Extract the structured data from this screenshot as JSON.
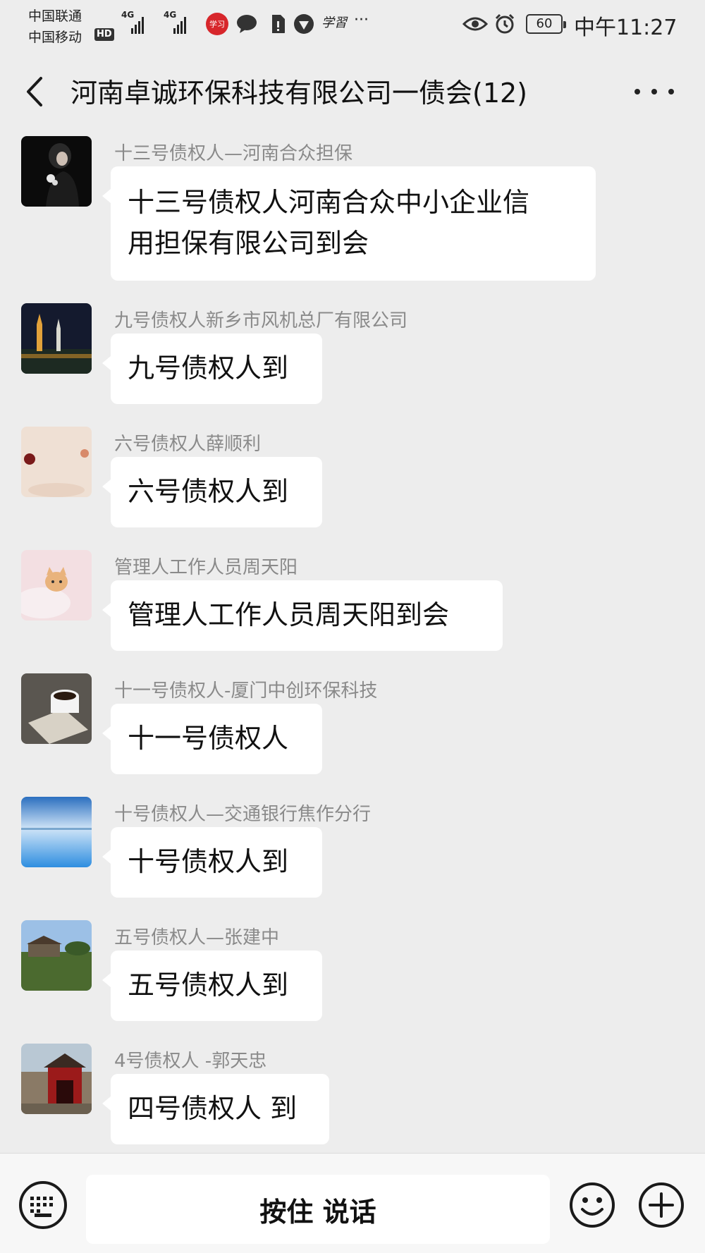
{
  "status_bar": {
    "carrier_1": "中国联通",
    "carrier_2": "中国移动",
    "hd": "HD",
    "network_1": "4G",
    "network_2": "4G",
    "app_badge": "学习",
    "xue_icon_text": "学習",
    "more": "···",
    "battery": "60",
    "time": "中午11:27"
  },
  "header": {
    "title": "河南卓诚环保科技有限公司一债会(12)"
  },
  "messages": [
    {
      "sender": "十三号债权人—河南合众担保",
      "text_line1": "十三号债权人河南合众中小企业信",
      "text_line2": "用担保有限公司到会"
    },
    {
      "sender": "九号债权人新乡市风机总厂有限公司",
      "text": "九号债权人到"
    },
    {
      "sender": "六号债权人薛顺利",
      "text": "六号债权人到"
    },
    {
      "sender": "管理人工作人员周天阳",
      "text": "管理人工作人员周天阳到会"
    },
    {
      "sender": "十一号债权人-厦门中创环保科技",
      "text": "十一号债权人"
    },
    {
      "sender": "十号债权人—交通银行焦作分行",
      "text": "十号债权人到"
    },
    {
      "sender": "五号债权人—张建中",
      "text": "五号债权人到"
    },
    {
      "sender": "4号债权人 -郭天忠",
      "text": "四号债权人 到"
    }
  ],
  "input_bar": {
    "hold_to_talk": "按住 说话"
  },
  "icons": {
    "back": "chevron-left-icon",
    "more": "more-dots-icon",
    "keyboard": "keyboard-icon",
    "emoji": "emoji-icon",
    "plus": "plus-icon"
  }
}
